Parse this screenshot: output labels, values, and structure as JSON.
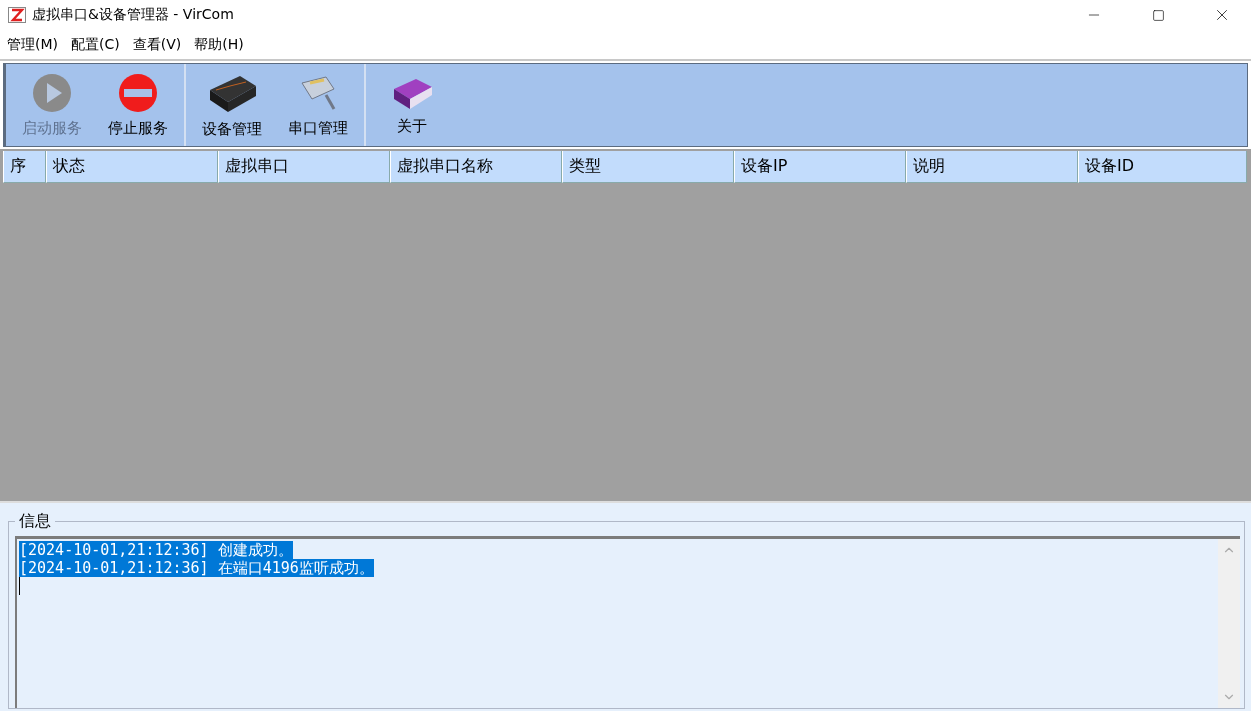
{
  "window": {
    "title": "虚拟串口&设备管理器 - VirCom"
  },
  "menu": [
    {
      "label": "管理(M)"
    },
    {
      "label": "配置(C)"
    },
    {
      "label": "查看(V)"
    },
    {
      "label": "帮助(H)"
    }
  ],
  "toolbar": [
    [
      {
        "label": "启动服务",
        "kind": "start",
        "disabled": true
      },
      {
        "label": "停止服务",
        "kind": "stop",
        "disabled": false
      }
    ],
    [
      {
        "label": "设备管理",
        "kind": "device",
        "disabled": false
      },
      {
        "label": "串口管理",
        "kind": "port",
        "disabled": false
      }
    ],
    [
      {
        "label": "关于",
        "kind": "about",
        "disabled": false
      }
    ]
  ],
  "table": {
    "columns": [
      "序",
      "状态",
      "虚拟串口",
      "虚拟串口名称",
      "类型",
      "设备IP",
      "说明",
      "设备ID"
    ]
  },
  "info": {
    "title": "信息",
    "lines": [
      {
        "text": "[2024-10-01,21:12:36] 创建成功。",
        "selected": true
      },
      {
        "text": "[2024-10-01,21:12:36] 在端口4196监听成功。",
        "selected": true
      }
    ]
  }
}
